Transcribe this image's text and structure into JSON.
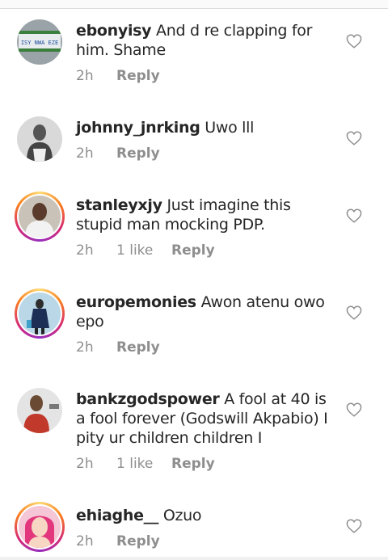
{
  "comments": [
    {
      "username": "ebonyisy",
      "text": "And d re clapping for him. Shame",
      "time": "2h",
      "likes": "",
      "reply": "Reply"
    },
    {
      "username": "johnny_jnrking",
      "text": "Uwo lll",
      "time": "2h",
      "likes": "",
      "reply": "Reply"
    },
    {
      "username": "stanleyxjy",
      "text": "Just imagine this stupid man mocking PDP.",
      "time": "2h",
      "likes": "1 like",
      "reply": "Reply"
    },
    {
      "username": "europemonies",
      "text": "Awon atenu owo epo",
      "time": "2h",
      "likes": "",
      "reply": "Reply"
    },
    {
      "username": "bankzgodspower",
      "text": "A fool at 40 is a fool forever (Godswill Akpabio) I pity ur children children I",
      "time": "2h",
      "likes": "1 like",
      "reply": "Reply"
    },
    {
      "username": "ehiaghe__",
      "text": "Ozuo",
      "time": "2h",
      "likes": "",
      "reply": "Reply"
    }
  ],
  "avatar_badges": {
    "plate_text": "ISY NWA EZE"
  },
  "icons": {
    "like": "heart-outline-icon"
  },
  "colors": {
    "text": "#262626",
    "meta": "#8e8e8e",
    "divider": "#dbdbdb"
  }
}
